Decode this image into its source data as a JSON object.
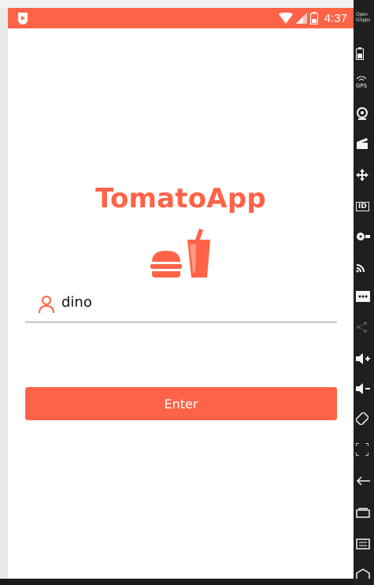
{
  "status_bar": {
    "time": "4:37",
    "color": "#ff6347"
  },
  "login": {
    "app_title": "TomatoApp",
    "username_value": "dino",
    "enter_label": "Enter",
    "accent_color": "#ff6347"
  },
  "emulator_toolbar": {
    "brand": "Open GApps",
    "icons": [
      "battery-icon",
      "gps-icon",
      "camera-icon",
      "clapper-icon",
      "move-icon",
      "id-icon",
      "media-icon",
      "cast-icon",
      "more-icon",
      "share-icon",
      "volume-up-icon",
      "volume-down-icon",
      "rotate-icon",
      "resize-icon",
      "back-icon",
      "recent-apps-icon",
      "menu-icon",
      "home-icon"
    ],
    "gps_label": "GPS",
    "id_label": "ID"
  }
}
